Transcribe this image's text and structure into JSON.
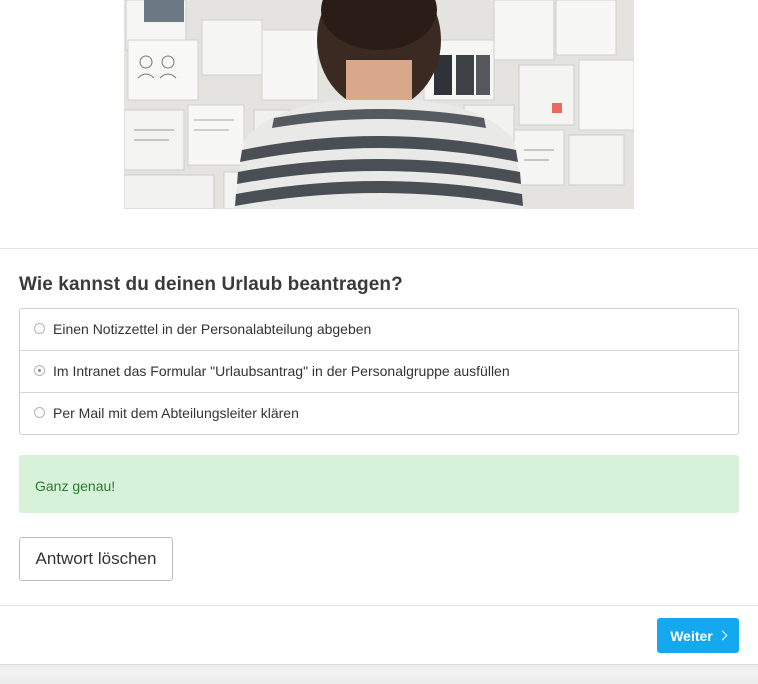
{
  "hero": {
    "description_icon": "image-person-at-whiteboard"
  },
  "question": {
    "title": "Wie kannst du deinen Urlaub beantragen?",
    "options": [
      {
        "label": "Einen Notizzettel in der Personalabteilung abgeben",
        "selected": false
      },
      {
        "label": "Im Intranet das Formular \"Urlaubsantrag\" in der Personalgruppe ausfüllen",
        "selected": true
      },
      {
        "label": "Per Mail mit dem Abteilungsleiter klären",
        "selected": false
      }
    ]
  },
  "feedback": {
    "text": "Ganz genau!",
    "color": "#d6f2d9",
    "text_color": "#2c7a32"
  },
  "actions": {
    "clear_label": "Antwort löschen",
    "next_label": "Weiter",
    "next_icon": "chevron-right-icon",
    "accent": "#14a9ee"
  }
}
